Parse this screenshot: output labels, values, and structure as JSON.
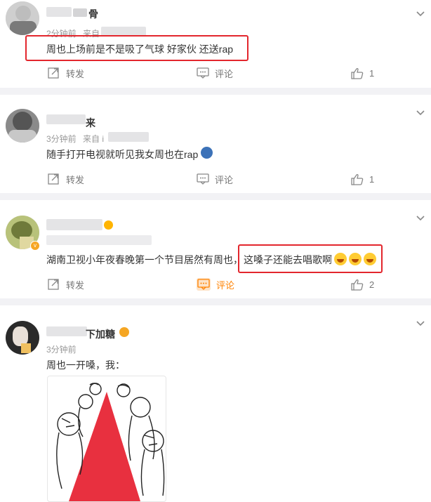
{
  "posts": [
    {
      "username_visible": "骨",
      "time": "2分钟前",
      "source_prefix": "来自",
      "text": "周也上场前是不是吸了气球 好家伙 还送rap",
      "repost_label": "转发",
      "comment_label": "评论",
      "like_count": "1"
    },
    {
      "username_visible": "来",
      "time": "3分钟前",
      "source_prefix": "来自 i",
      "text": "随手打开电视就听见我女周也在rap",
      "repost_label": "转发",
      "comment_label": "评论",
      "like_count": "1"
    },
    {
      "username_visible": "",
      "time": "",
      "source_prefix": "",
      "text_part1": "湖南卫视小年夜春晚第一个节目居然有周也，",
      "text_part2": "这嗓子还能去唱歌啊",
      "repost_label": "转发",
      "comment_label": "评论",
      "like_count": "2"
    },
    {
      "username_visible": "下加糖",
      "time": "3分钟前",
      "text": "周也一开嗓，我："
    }
  ],
  "colors": {
    "highlight_box": "#e3262d",
    "separator": "#f2f2f5",
    "comment_active": "#ff8200"
  }
}
